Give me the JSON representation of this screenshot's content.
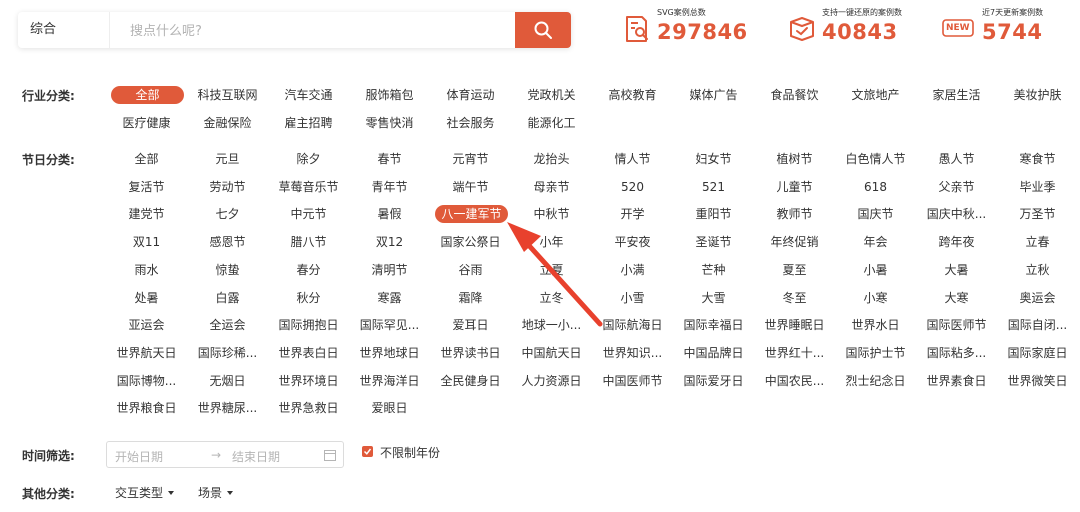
{
  "search": {
    "type_label": "综合",
    "placeholder": "搜点什么呢?"
  },
  "stats": [
    {
      "label": "SVG案例总数",
      "value": "297846",
      "icon": "document-search-icon"
    },
    {
      "label": "支持一键还原的案例数",
      "value": "40843",
      "icon": "restore-box-icon"
    },
    {
      "label": "近7天更新案例数",
      "value": "5744",
      "icon": "new-badge-icon",
      "badge": "NEW"
    }
  ],
  "colors": {
    "accent": "#e05a3a"
  },
  "industry": {
    "label": "行业分类:",
    "items": [
      "全部",
      "科技互联网",
      "汽车交通",
      "服饰箱包",
      "体育运动",
      "党政机关",
      "高校教育",
      "媒体广告",
      "食品餐饮",
      "文旅地产",
      "家居生活",
      "美妆护肤",
      "医疗健康",
      "金融保险",
      "雇主招聘",
      "零售快消",
      "社会服务",
      "能源化工"
    ],
    "active": "全部"
  },
  "festival": {
    "label": "节日分类:",
    "items": [
      "全部",
      "元旦",
      "除夕",
      "春节",
      "元宵节",
      "龙抬头",
      "情人节",
      "妇女节",
      "植树节",
      "白色情人节",
      "愚人节",
      "寒食节",
      "复活节",
      "劳动节",
      "草莓音乐节",
      "青年节",
      "端午节",
      "母亲节",
      "520",
      "521",
      "儿童节",
      "618",
      "父亲节",
      "毕业季",
      "建党节",
      "七夕",
      "中元节",
      "暑假",
      "八一建军节",
      "中秋节",
      "开学",
      "重阳节",
      "教师节",
      "国庆节",
      "国庆中秋...",
      "万圣节",
      "双11",
      "感恩节",
      "腊八节",
      "双12",
      "国家公祭日",
      "小年",
      "平安夜",
      "圣诞节",
      "年终促销",
      "年会",
      "跨年夜",
      "立春",
      "雨水",
      "惊蛰",
      "春分",
      "清明节",
      "谷雨",
      "立夏",
      "小满",
      "芒种",
      "夏至",
      "小暑",
      "大暑",
      "立秋",
      "处暑",
      "白露",
      "秋分",
      "寒露",
      "霜降",
      "立冬",
      "小雪",
      "大雪",
      "冬至",
      "小寒",
      "大寒",
      "奥运会",
      "亚运会",
      "全运会",
      "国际拥抱日",
      "国际罕见...",
      "爱耳日",
      "地球一小...",
      "国际航海日",
      "国际幸福日",
      "世界睡眠日",
      "世界水日",
      "国际医师节",
      "国际自闭...",
      "世界航天日",
      "国际珍稀...",
      "世界表白日",
      "世界地球日",
      "世界读书日",
      "中国航天日",
      "世界知识...",
      "中国品牌日",
      "世界红十...",
      "国际护士节",
      "国际粘多...",
      "国际家庭日",
      "国际博物...",
      "无烟日",
      "世界环境日",
      "世界海洋日",
      "全民健身日",
      "人力资源日",
      "中国医师节",
      "国际爱牙日",
      "中国农民...",
      "烈士纪念日",
      "世界素食日",
      "世界微笑日",
      "世界粮食日",
      "世界糖尿...",
      "世界急救日",
      "爱眼日"
    ],
    "active": "八一建军节"
  },
  "time": {
    "label": "时间筛选:",
    "start_placeholder": "开始日期",
    "separator": "→",
    "end_placeholder": "结束日期",
    "unlimited_label": "不限制年份",
    "unlimited_checked": true
  },
  "other": {
    "label": "其他分类:",
    "dropdowns": [
      "交互类型",
      "场景"
    ]
  }
}
